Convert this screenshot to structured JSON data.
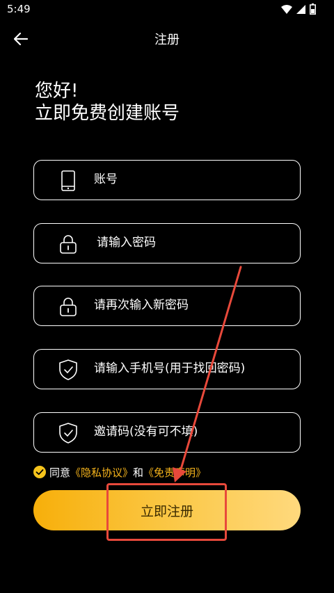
{
  "status_bar": {
    "time": "5:49",
    "icons": [
      "wifi-icon",
      "signal-icon",
      "battery-icon"
    ]
  },
  "app_bar": {
    "title": "注册",
    "back_icon": "arrow-left-icon"
  },
  "greeting": {
    "line1": "您好!",
    "line2": "立即免费创建账号"
  },
  "form": {
    "fields": [
      {
        "name": "account",
        "icon": "phone-icon",
        "placeholder": "账号"
      },
      {
        "name": "password",
        "icon": "lock-icon",
        "placeholder": "请输入密码"
      },
      {
        "name": "confirm-password",
        "icon": "lock-icon",
        "placeholder": "请再次输入新密码"
      },
      {
        "name": "phone",
        "icon": "shield-check-icon",
        "placeholder": "请输入手机号(用于找回密码)"
      },
      {
        "name": "invite-code",
        "icon": "shield-check-icon",
        "placeholder": "邀请码(没有可不填)"
      }
    ]
  },
  "agreement": {
    "checked": true,
    "prefix": "同意",
    "privacy_link": "《隐私协议》",
    "and": "和",
    "disclaimer_link": "《免责声明》"
  },
  "register_button": {
    "label": "立即注册"
  },
  "colors": {
    "background": "#000000",
    "accent": "#F6B41C",
    "button_gradient_start": "#F7AF0A",
    "button_gradient_end": "#FFD97D",
    "annotation_red": "#E8493B"
  }
}
